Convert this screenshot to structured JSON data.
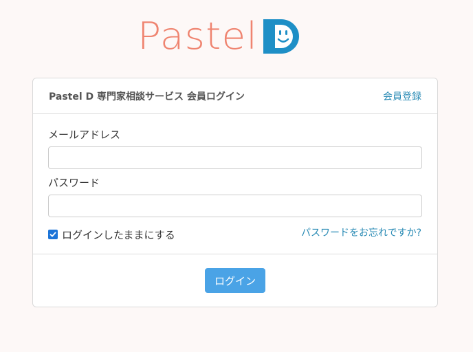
{
  "logo": {
    "text": "Pastel"
  },
  "card": {
    "title": "Pastel D 専門家相談サービス 会員ログイン",
    "register_label": "会員登録"
  },
  "form": {
    "email_label": "メールアドレス",
    "email_value": "",
    "password_label": "パスワード",
    "password_value": "",
    "remember_label": "ログインしたままにする",
    "remember_checked": true,
    "forgot_label": "パスワードをお忘れですか?"
  },
  "actions": {
    "login_label": "ログイン"
  },
  "colors": {
    "background": "#fdf8f7",
    "logo_text": "#ef8470",
    "logo_d": "#1e8fc6",
    "link": "#2a8bb5",
    "button": "#4aa3e6",
    "checkbox": "#1c74d8"
  },
  "icons": {
    "logo_mark": "smiling-d-icon",
    "checkbox": "checkmark-icon"
  }
}
